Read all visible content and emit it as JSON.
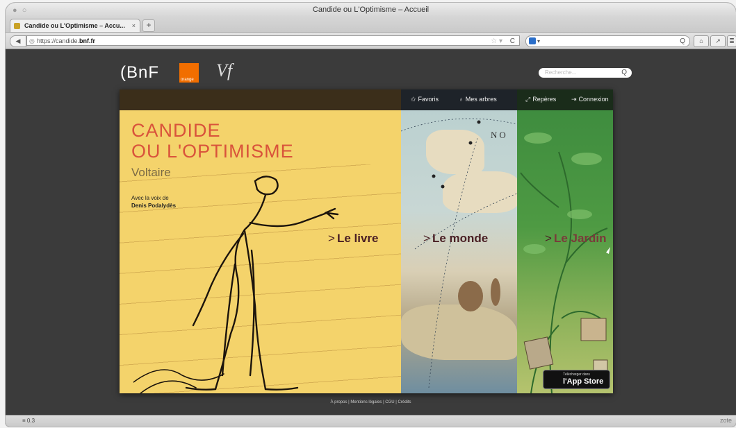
{
  "browser": {
    "window_title": "Candide ou L'Optimisme – Accueil",
    "tab_label": "Candide ou L'Optimisme – Accu...",
    "tab_close": "×",
    "new_tab": "+",
    "url_prefix": "https://candide.",
    "url_domain": "bnf.fr",
    "back": "◀",
    "star": "☆ ▾",
    "reload": "C",
    "search_mag": "Q",
    "status_left": "≡  0.3",
    "status_right": "zote"
  },
  "site": {
    "logo_bnf": "(BnF",
    "logo_orange": "orange",
    "logo_vf": "Vf",
    "search_placeholder": "Recherche...",
    "search_icon": "Q",
    "nav": {
      "favoris": "Favoris",
      "mes_arbres": "Mes arbres",
      "reperes": "Repères",
      "connexion": "Connexion"
    },
    "livre": {
      "title_line1": "CANDIDE",
      "title_line2": "OU L'OPTIMISME",
      "author": "Voltaire",
      "voice_label": "Avec la voix de",
      "voice_name": "Denis Podalydès",
      "enter": "Le livre"
    },
    "monde": {
      "enter": "Le monde",
      "map_text": "NO"
    },
    "jardin": {
      "enter": "Le Jardin"
    },
    "appstore": {
      "small": "Télécharger dans",
      "big": "l'App Store"
    },
    "footer": "À propos | Mentions légales | CGU | Crédits"
  }
}
